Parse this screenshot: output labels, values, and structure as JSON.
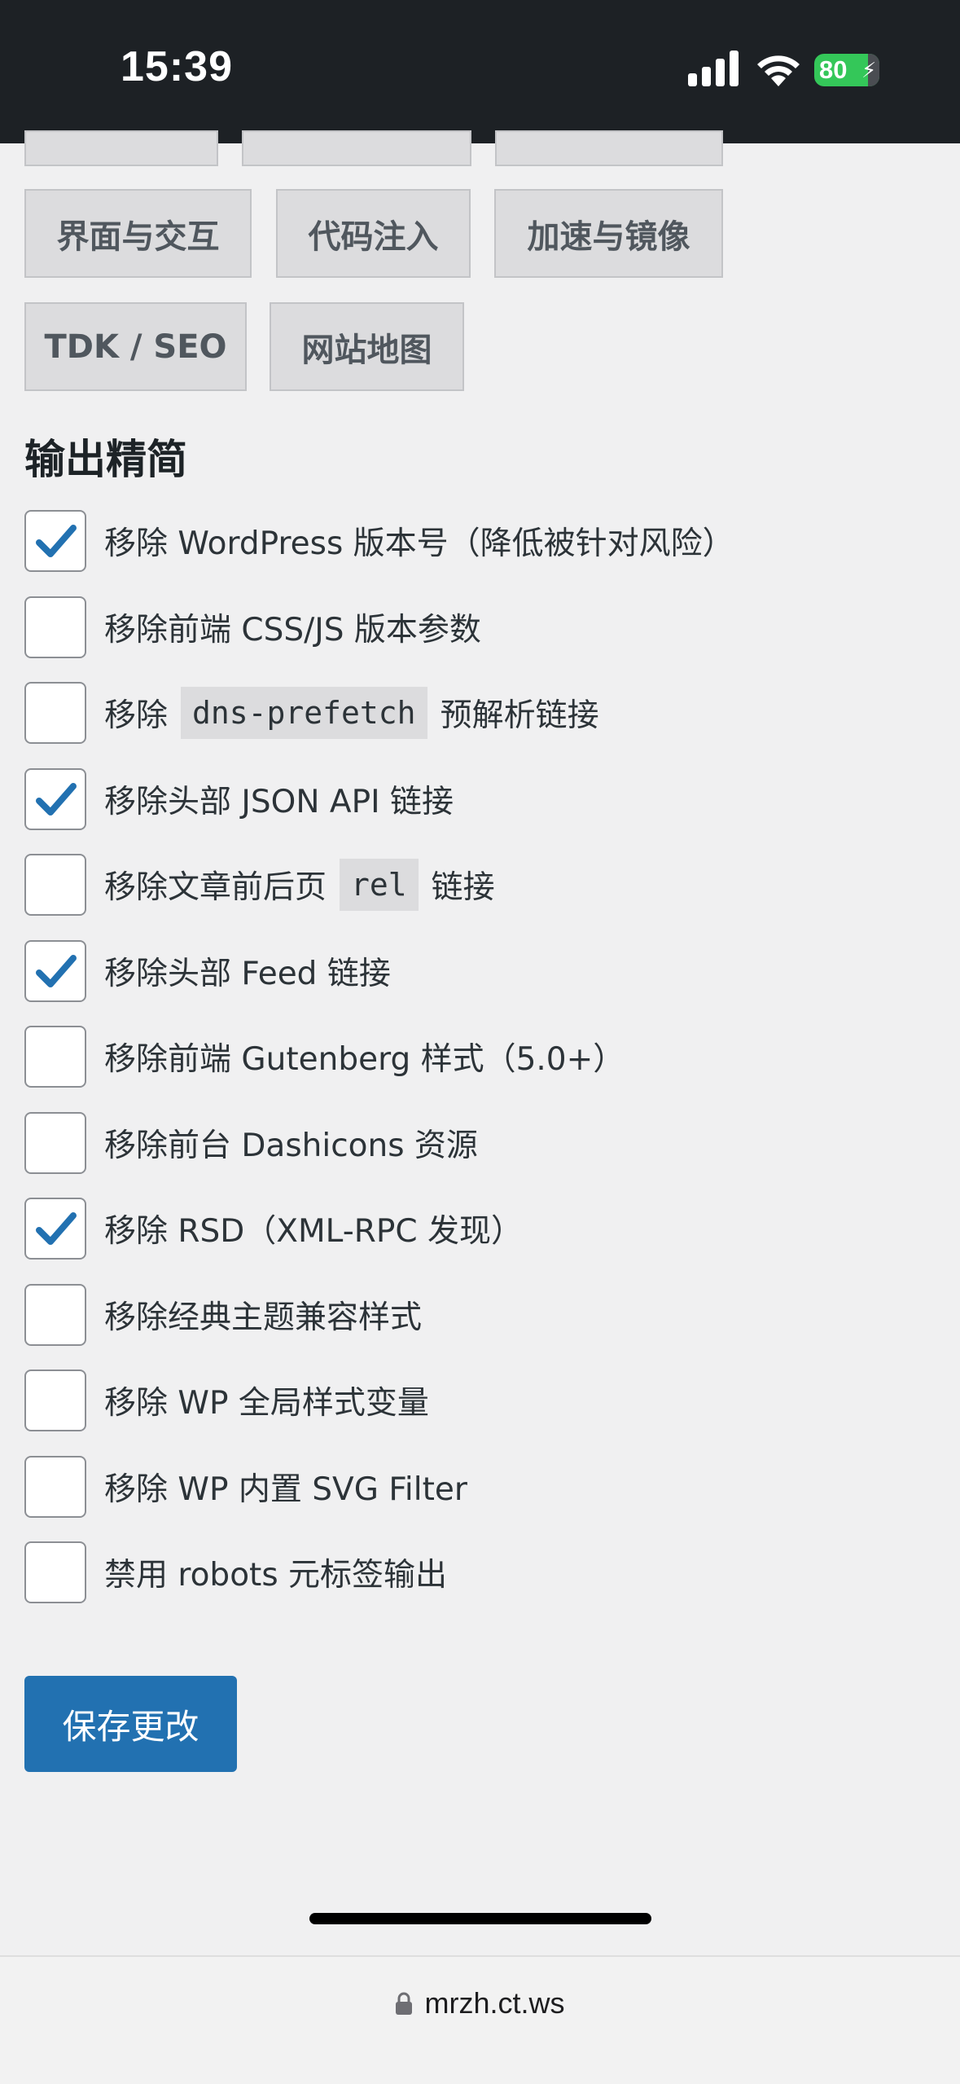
{
  "status_bar": {
    "time": "15:39",
    "battery": "80"
  },
  "tabs": {
    "row2": [
      "界面与交互",
      "代码注入",
      "加速与镜像"
    ],
    "row3": [
      "TDK / SEO",
      "网站地图"
    ]
  },
  "section_title": "输出精简",
  "options": [
    {
      "label_before": "移除 WordPress 版本号（降低被针对风险）",
      "checked": true
    },
    {
      "label_before": "移除前端 CSS/JS 版本参数",
      "checked": false
    },
    {
      "label_before": "移除",
      "code": "dns-prefetch",
      "label_after": "预解析链接",
      "checked": false
    },
    {
      "label_before": "移除头部 JSON API 链接",
      "checked": true
    },
    {
      "label_before": "移除文章前后页",
      "code": "rel",
      "label_after": "链接",
      "checked": false
    },
    {
      "label_before": "移除头部 Feed 链接",
      "checked": true
    },
    {
      "label_before": "移除前端 Gutenberg 样式（5.0+）",
      "checked": false
    },
    {
      "label_before": "移除前台 Dashicons 资源",
      "checked": false
    },
    {
      "label_before": "移除 RSD（XML-RPC 发现）",
      "checked": true
    },
    {
      "label_before": "移除经典主题兼容样式",
      "checked": false
    },
    {
      "label_before": "移除 WP 全局样式变量",
      "checked": false
    },
    {
      "label_before": "移除 WP 内置 SVG Filter",
      "checked": false
    },
    {
      "label_before": "禁用 robots 元标签输出",
      "checked": false
    }
  ],
  "save_button": "保存更改",
  "browser": {
    "url": "mrzh.ct.ws"
  },
  "colors": {
    "accent": "#2271b1",
    "check": "#2271b1",
    "statusbar": "#1d2125"
  }
}
